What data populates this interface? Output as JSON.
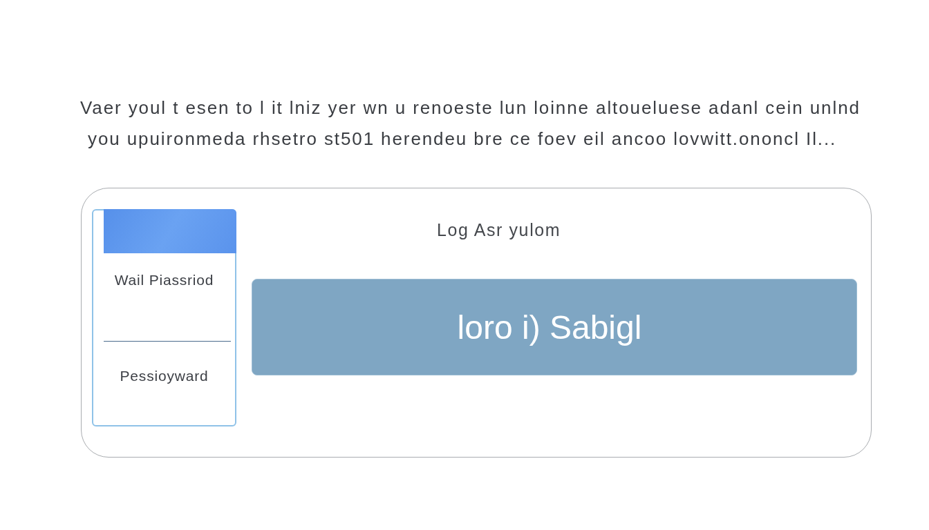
{
  "intro": {
    "lines": [
      "Vaer youl t esen to l it lniz yer wn u renoeste lun loinne altoueluese adanl cein unlnd",
      "you upuironmeda rhsetro st501 herendeu bre ce foev eil ancoo lovwitt.ononcl Il..."
    ]
  },
  "login_card": {
    "side_panel": {
      "items": [
        {
          "kind": "label",
          "text": "Wail Piassriod"
        },
        {
          "kind": "field"
        },
        {
          "kind": "label",
          "text": "Pessioyward"
        }
      ]
    },
    "heading": "Log Asr yulom",
    "button": {
      "label": "loro i) Sabigl"
    }
  }
}
